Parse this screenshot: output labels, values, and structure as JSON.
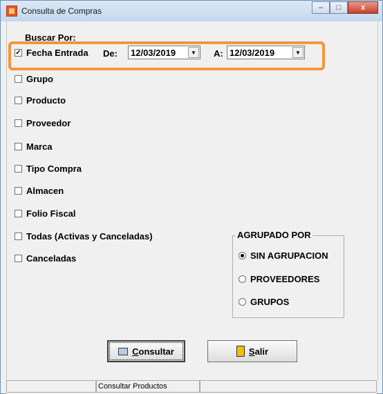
{
  "window": {
    "title": "Consulta de Compras",
    "controls": {
      "minimize": "–",
      "maximize": "□",
      "close": "x"
    }
  },
  "filters": {
    "heading": "Buscar Por:",
    "fecha": {
      "label": "Fecha Entrada",
      "checked": true,
      "check_mark": "✓",
      "de_label": "De:",
      "de_value": "12/03/2019",
      "a_label": "A:",
      "a_value": "12/03/2019"
    },
    "options": [
      {
        "label": "Grupo",
        "checked": false
      },
      {
        "label": "Producto",
        "checked": false
      },
      {
        "label": "Proveedor",
        "checked": false
      },
      {
        "label": "Marca",
        "checked": false
      },
      {
        "label": "Tipo Compra",
        "checked": false
      },
      {
        "label": "Almacen",
        "checked": false
      },
      {
        "label": "Folio Fiscal",
        "checked": false
      },
      {
        "label": "Todas (Activas y Canceladas)",
        "checked": false
      },
      {
        "label": "Canceladas",
        "checked": false
      }
    ]
  },
  "agrupado": {
    "title": "AGRUPADO POR",
    "options": [
      {
        "label": "SIN AGRUPACION",
        "selected": true
      },
      {
        "label": "PROVEEDORES",
        "selected": false
      },
      {
        "label": "GRUPOS",
        "selected": false
      }
    ]
  },
  "buttons": {
    "consultar": {
      "hotkey": "C",
      "rest": "onsultar",
      "icon": "book-icon"
    },
    "salir": {
      "hotkey": "S",
      "rest": "alir",
      "icon": "door-icon"
    }
  },
  "statusbar": {
    "panels": [
      "",
      "Consultar Productos",
      ""
    ]
  },
  "colors": {
    "highlight": "#f3953c",
    "titlebar": "#c3d8ee",
    "close_button": "#c7402a"
  }
}
